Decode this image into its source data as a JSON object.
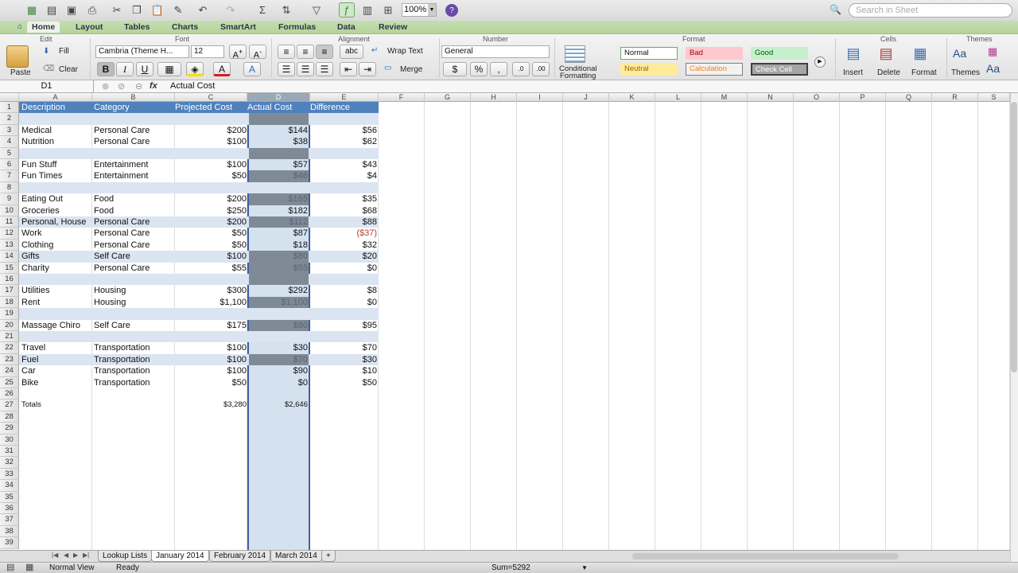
{
  "toolbar": {
    "zoom": "100%",
    "search_placeholder": "Search in Sheet"
  },
  "tabs": [
    "Home",
    "Layout",
    "Tables",
    "Charts",
    "SmartArt",
    "Formulas",
    "Data",
    "Review"
  ],
  "ribbon": {
    "groups": {
      "edit": "Edit",
      "font": "Font",
      "alignment": "Alignment",
      "number": "Number",
      "format": "Format",
      "cells": "Cells",
      "themes": "Themes"
    },
    "paste": "Paste",
    "fill": "Fill",
    "clear": "Clear",
    "font_name": "Cambria (Theme H...",
    "font_size": "12",
    "bold": "B",
    "italic": "I",
    "underline": "U",
    "wrap_text": "Wrap Text",
    "merge": "Merge",
    "abc": "abc",
    "number_format": "General",
    "percent": "%",
    "comma": ",",
    "conditional_formatting_1": "Conditional",
    "conditional_formatting_2": "Formatting",
    "styles": {
      "normal": "Normal",
      "bad": "Bad",
      "good": "Good",
      "neutral": "Neutral",
      "calculation": "Calculation",
      "check_cell": "Check Cell"
    },
    "insert": "Insert",
    "delete": "Delete",
    "format": "Format",
    "themes": "Themes",
    "aa": "Aa"
  },
  "formula_bar": {
    "name_box": "D1",
    "fx": "fx",
    "value": "Actual Cost"
  },
  "columns": [
    "A",
    "B",
    "C",
    "D",
    "E",
    "F",
    "G",
    "H",
    "I",
    "J",
    "K",
    "L",
    "M",
    "N",
    "O",
    "P",
    "Q",
    "R",
    "S"
  ],
  "header": {
    "a": "Description",
    "b": "Category",
    "c": "Projected Cost",
    "d": "Actual Cost",
    "e": "Difference"
  },
  "rows": {
    "r3": {
      "a": "Medical",
      "b": "Personal Care",
      "c": "$200",
      "d": "$144",
      "e": "$56"
    },
    "r4": {
      "a": "Nutrition",
      "b": "Personal Care",
      "c": "$100",
      "d": "$38",
      "e": "$62"
    },
    "r6": {
      "a": "Fun Stuff",
      "b": "Entertainment",
      "c": "$100",
      "d": "$57",
      "e": "$43"
    },
    "r7": {
      "a": "Fun Times",
      "b": "Entertainment",
      "c": "$50",
      "d": "$46",
      "e": "$4"
    },
    "r9": {
      "a": "Eating Out",
      "b": "Food",
      "c": "$200",
      "d": "$165",
      "e": "$35"
    },
    "r10": {
      "a": "Groceries",
      "b": "Food",
      "c": "$250",
      "d": "$182",
      "e": "$68"
    },
    "r11": {
      "a": "Personal, House",
      "b": "Personal Care",
      "c": "$200",
      "d": "$112",
      "e": "$88"
    },
    "r12": {
      "a": "Work",
      "b": "Personal Care",
      "c": "$50",
      "d": "$87",
      "e": "($37)"
    },
    "r13": {
      "a": "Clothing",
      "b": "Personal Care",
      "c": "$50",
      "d": "$18",
      "e": "$32"
    },
    "r14": {
      "a": "Gifts",
      "b": "Self Care",
      "c": "$100",
      "d": "$80",
      "e": "$20"
    },
    "r15": {
      "a": "Charity",
      "b": "Personal Care",
      "c": "$55",
      "d": "$55",
      "e": "$0"
    },
    "r17": {
      "a": "Utilities",
      "b": "Housing",
      "c": "$300",
      "d": "$292",
      "e": "$8"
    },
    "r18": {
      "a": "Rent",
      "b": "Housing",
      "c": "$1,100",
      "d": "$1,100",
      "e": "$0"
    },
    "r20": {
      "a": "Massage Chiro",
      "b": "Self Care",
      "c": "$175",
      "d": "$80",
      "e": "$95"
    },
    "r22": {
      "a": "Travel",
      "b": "Transportation",
      "c": "$100",
      "d": "$30",
      "e": "$70"
    },
    "r23": {
      "a": "Fuel",
      "b": "Transportation",
      "c": "$100",
      "d": "$70",
      "e": "$30"
    },
    "r24": {
      "a": "Car",
      "b": "Transportation",
      "c": "$100",
      "d": "$90",
      "e": "$10"
    },
    "r25": {
      "a": "Bike",
      "b": "Transportation",
      "c": "$50",
      "d": "$0",
      "e": "$50"
    },
    "r27": {
      "a": "Totals",
      "c": "$3,280",
      "d": "$2,646"
    }
  },
  "sheet_tabs": [
    "Lookup Lists",
    "January 2014",
    "February 2014",
    "March 2014"
  ],
  "add_sheet": "+",
  "status": {
    "view": "Normal View",
    "ready": "Ready",
    "sum": "Sum=5292"
  }
}
